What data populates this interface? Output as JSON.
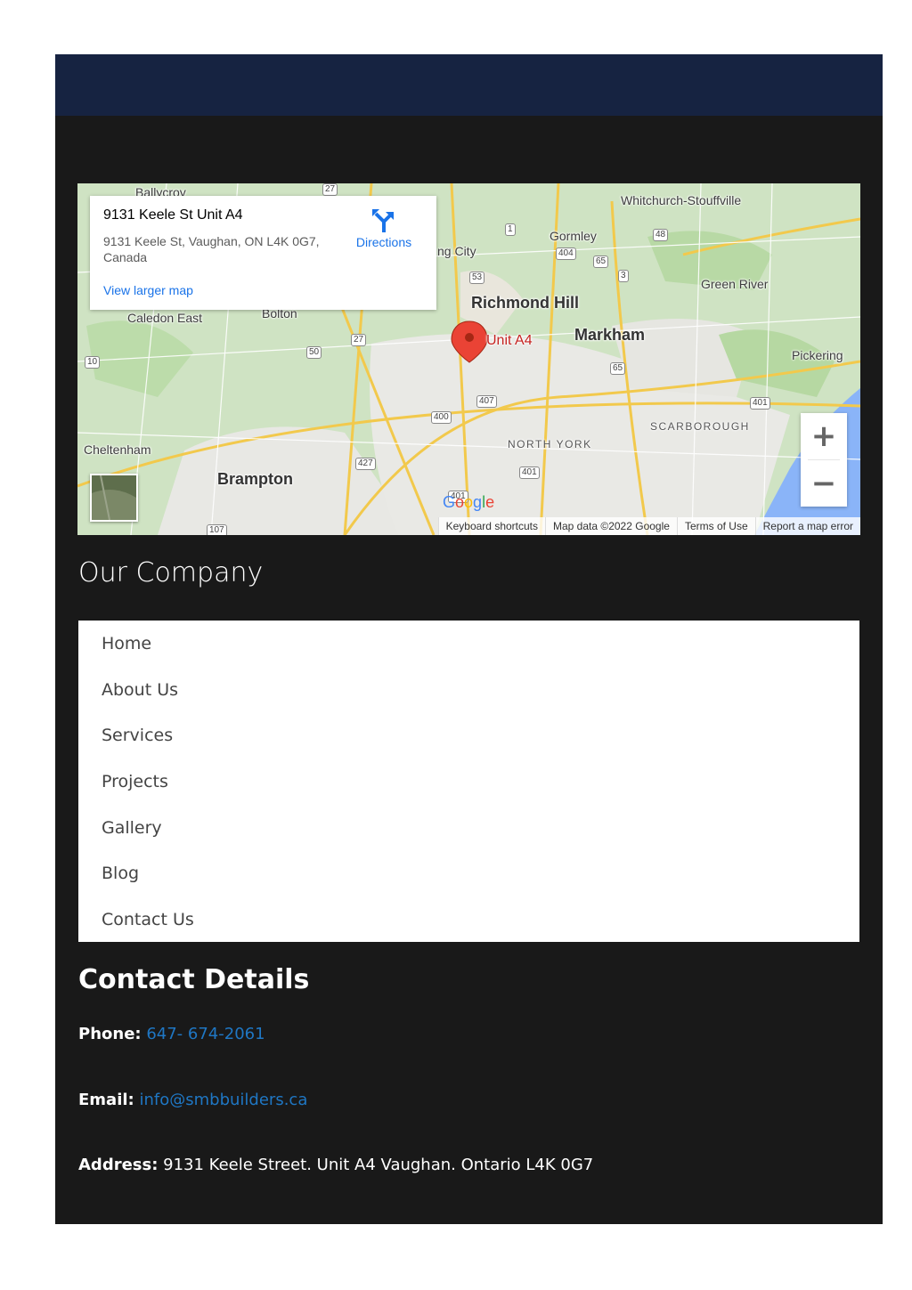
{
  "map": {
    "info_card": {
      "title": "9131 Keele St Unit A4",
      "address": "9131 Keele St, Vaughan, ON L4K 0G7, Canada",
      "larger_map_label": "View larger map",
      "directions_label": "Directions"
    },
    "pin_label": "Unit A4",
    "places": {
      "ballycroy": "Ballycroy",
      "whitchurch": "Whitchurch-Stouffville",
      "gormley": "Gormley",
      "king_city": "ng City",
      "green_river": "Green River",
      "richmond_hill": "Richmond Hill",
      "caledon_east": "Caledon East",
      "bolton": "Bolton",
      "markham": "Markham",
      "pickering": "Pickering",
      "scarborough": "SCARBOROUGH",
      "north_york": "NORTH YORK",
      "cheltenham": "Cheltenham",
      "brampton": "Brampton"
    },
    "shields": [
      "27",
      "1",
      "48",
      "404",
      "65",
      "53",
      "3",
      "27",
      "50",
      "10",
      "65",
      "407",
      "400",
      "401",
      "427",
      "401",
      "401",
      "107"
    ],
    "zoom_in": "+",
    "zoom_out": "−",
    "google_logo": "Google",
    "attribution": {
      "shortcuts": "Keyboard shortcuts",
      "map_data": "Map data ©2022 Google",
      "terms": "Terms of Use",
      "report": "Report a map error"
    }
  },
  "company": {
    "heading": "Our Company",
    "menu": [
      "Home",
      "About Us",
      "Services",
      "Projects",
      "Gallery",
      "Blog",
      "Contact Us"
    ]
  },
  "contact": {
    "heading": "Contact Details",
    "phone_label": "Phone:",
    "phone_value": "647- 674-2061",
    "email_label": "Email:",
    "email_value": "info@smbbuilders.ca",
    "address_label": "Address:",
    "address_value": "9131 Keele Street. Unit A4 Vaughan. Ontario L4K 0G7"
  },
  "colors": {
    "header_bar": "#162341",
    "page_background": "#191919",
    "link": "#1f77c4",
    "pin": "#ea4335"
  }
}
